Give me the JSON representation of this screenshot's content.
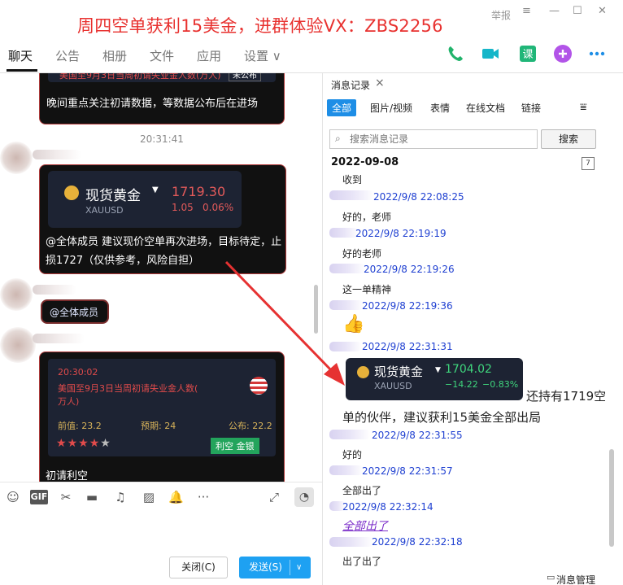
{
  "title_bar": {
    "promo_text": "周四空单获利15美金，进群体验VX：ZBS2256",
    "report_label": "举报"
  },
  "tabs": [
    {
      "label": "聊天"
    },
    {
      "label": "公告"
    },
    {
      "label": "相册"
    },
    {
      "label": "文件"
    },
    {
      "label": "应用"
    },
    {
      "label": "设置 ∨"
    }
  ],
  "chat": {
    "top_event_title": "美国至9月3日当周初请失业金人数(万人)",
    "top_event_badge": "未公布",
    "msg1_text": "晚间重点关注初请数据，等数据公布后在进场",
    "time_1": "20:31:41",
    "quote_card": {
      "name": "现货黄金",
      "code": "XAUUSD",
      "price": "1719.30",
      "change": "1.05",
      "change_pct": "0.06%"
    },
    "msg2_text_line1": "@全体成员 建议现价空单再次进场，目标待定，止",
    "msg2_text_line2": "损1727（仅供参考，风险自担）",
    "mention_text": "@全体成员",
    "event_card": {
      "time": "20:30:02",
      "title_line1": "美国至9月3日当周初请失业金人数(",
      "title_line2": "万人)",
      "prev_label": "前值: 23.2",
      "forecast_label": "预期: 24",
      "actual_label": "公布: 22.2",
      "stars": 4,
      "stars_max": 5,
      "pill_label": "利空  金银"
    },
    "msg4_text": "初请利空"
  },
  "composer": {
    "close_label": "关闭(C)",
    "send_label": "发送(S)"
  },
  "history": {
    "tab_title": "消息记录",
    "filters": [
      "全部",
      "图片/视频",
      "表情",
      "在线文档",
      "链接"
    ],
    "search_placeholder": "搜索消息记录",
    "search_button": "搜索",
    "date": "2022-09-08",
    "messages": [
      {
        "text": "收到"
      },
      {
        "time": "2022/9/8 22:08:25",
        "text": "好的，老师"
      },
      {
        "time": "2022/9/8 22:19:19",
        "text": "好的老师"
      },
      {
        "time": "2022/9/8 22:19:26",
        "text": "这一单精神"
      },
      {
        "time": "2022/9/8 22:19:36"
      },
      {
        "time": "2022/9/8 22:31:31"
      },
      {
        "time": "2022/9/8 22:31:55",
        "text": "好的"
      },
      {
        "time": "2022/9/8 22:31:57",
        "text": "全部出了"
      },
      {
        "time": "2022/9/8 22:32:14",
        "text": "全部出了"
      },
      {
        "time": "2022/9/8 22:32:18",
        "text": "出了出了"
      }
    ],
    "quote_card": {
      "name": "现货黄金",
      "code": "XAUUSD",
      "price": "1704.02",
      "change": "−14.22",
      "change_pct": "−0.83%"
    },
    "quote_caption_line1": "还持有1719空",
    "quote_caption_line2": "单的伙伴，建议获利15美金全部出局",
    "manage_label": "消息管理"
  },
  "colors": {
    "promo_red": "#e8312f",
    "accent_blue": "#1e8ee6",
    "send_blue": "#1ea1f2",
    "time_blue": "#1e3fd1",
    "link_purple": "#7b2dc9",
    "arrow_red": "#e63232"
  }
}
